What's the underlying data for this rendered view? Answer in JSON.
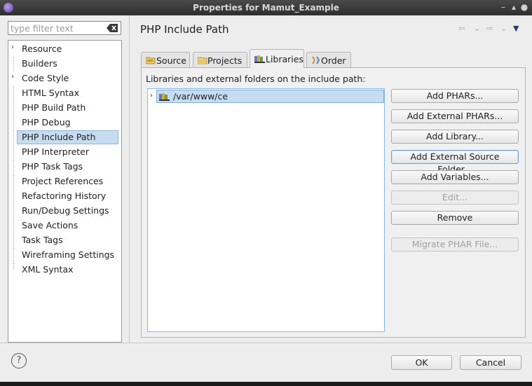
{
  "window": {
    "title": "Properties for Mamut_Example"
  },
  "filter": {
    "placeholder": "type filter text",
    "value": ""
  },
  "tree": {
    "items": [
      {
        "label": "Resource",
        "expandable": true,
        "selected": false
      },
      {
        "label": "Builders",
        "expandable": false,
        "selected": false
      },
      {
        "label": "Code Style",
        "expandable": true,
        "selected": false
      },
      {
        "label": "HTML Syntax",
        "expandable": false,
        "selected": false
      },
      {
        "label": "PHP Build Path",
        "expandable": false,
        "selected": false
      },
      {
        "label": "PHP Debug",
        "expandable": false,
        "selected": false
      },
      {
        "label": "PHP Include Path",
        "expandable": false,
        "selected": true
      },
      {
        "label": "PHP Interpreter",
        "expandable": false,
        "selected": false
      },
      {
        "label": "PHP Task Tags",
        "expandable": false,
        "selected": false
      },
      {
        "label": "Project References",
        "expandable": false,
        "selected": false
      },
      {
        "label": "Refactoring History",
        "expandable": false,
        "selected": false
      },
      {
        "label": "Run/Debug Settings",
        "expandable": false,
        "selected": false
      },
      {
        "label": "Save Actions",
        "expandable": false,
        "selected": false
      },
      {
        "label": "Task Tags",
        "expandable": false,
        "selected": false
      },
      {
        "label": "Wireframing Settings",
        "expandable": false,
        "selected": false
      },
      {
        "label": "XML Syntax",
        "expandable": false,
        "selected": false
      }
    ]
  },
  "page": {
    "title": "PHP Include Path"
  },
  "tabs": [
    {
      "label": "Source",
      "active": false
    },
    {
      "label": "Projects",
      "active": false
    },
    {
      "label": "Libraries",
      "active": true
    },
    {
      "label": "Order",
      "active": false
    }
  ],
  "libraries": {
    "caption": "Libraries and external folders on the include path:",
    "entries": [
      {
        "path": "/var/www/ce"
      }
    ]
  },
  "buttons": {
    "add_phars": "Add PHARs...",
    "add_external_phars": "Add External PHARs...",
    "add_library": "Add Library...",
    "add_external_source_folder": "Add External Source Folder...",
    "add_variables": "Add Variables...",
    "edit": "Edit...",
    "remove": "Remove",
    "migrate_phar_file": "Migrate PHAR File..."
  },
  "dialog": {
    "ok": "OK",
    "cancel": "Cancel"
  },
  "colors": {
    "selection": "#c7dcf1",
    "selection_border": "#7fb0dd",
    "accent": "#2a3d7a"
  },
  "icons": {
    "app": "eclipse-icon",
    "clear_filter": "clear-filter-icon",
    "source_tab": "source-folder-icon",
    "projects_tab": "projects-icon",
    "libraries_tab": "library-icon",
    "order_tab": "order-icon",
    "library_entry": "library-folder-icon",
    "help": "help-icon"
  }
}
